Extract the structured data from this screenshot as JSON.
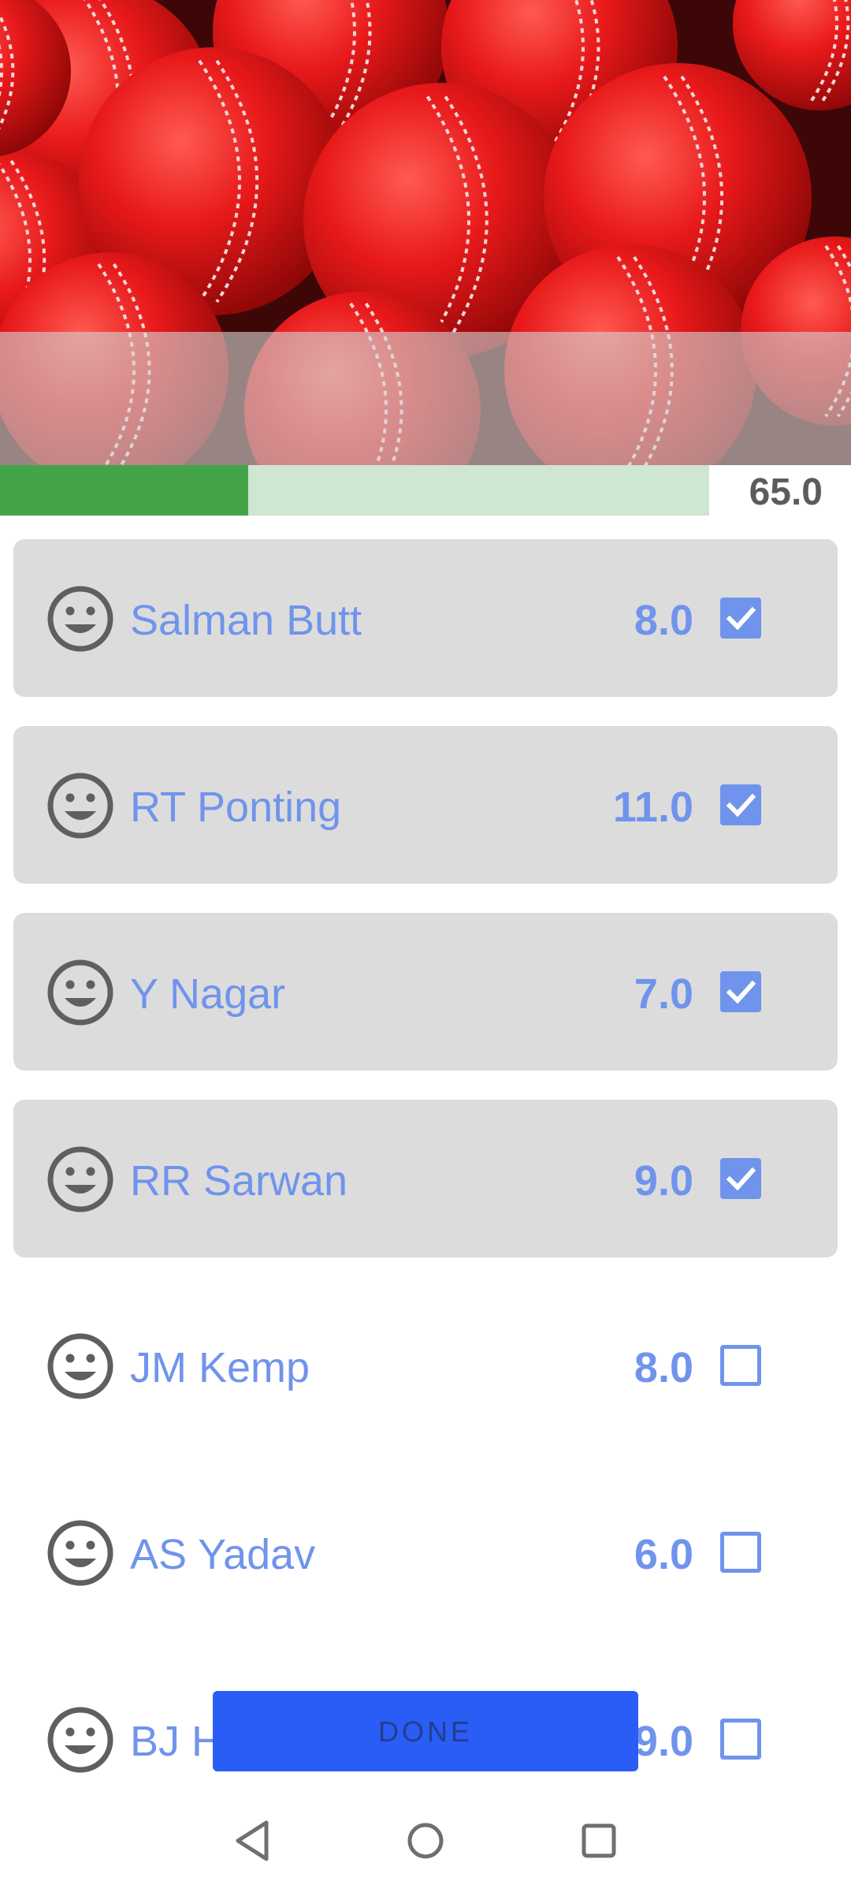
{
  "header": {
    "image_icon": "cricket-balls-image"
  },
  "budget": {
    "value_label": "65.0",
    "progress_fraction": 0.35,
    "fill_color": "#43a548",
    "track_color": "#cfe6d0"
  },
  "players": [
    {
      "name": "Salman Butt",
      "credit": "8.0",
      "selected": true
    },
    {
      "name": "RT Ponting",
      "credit": "11.0",
      "selected": true
    },
    {
      "name": "Y Nagar",
      "credit": "7.0",
      "selected": true
    },
    {
      "name": "RR Sarwan",
      "credit": "9.0",
      "selected": true
    },
    {
      "name": "JM Kemp",
      "credit": "8.0",
      "selected": false
    },
    {
      "name": "AS Yadav",
      "credit": "6.0",
      "selected": false
    },
    {
      "name": "BJ H",
      "credit": "9.0",
      "selected": false
    }
  ],
  "avatar_icon": "smiley-face-icon",
  "done_button": {
    "label": "DONE",
    "color": "#2a5cf6"
  },
  "nav": {
    "back_icon": "back-triangle-icon",
    "home_icon": "home-circle-icon",
    "recents_icon": "recents-square-icon"
  },
  "colors": {
    "accent": "#7094ec",
    "selected_row_bg": "#dcdcdc"
  }
}
